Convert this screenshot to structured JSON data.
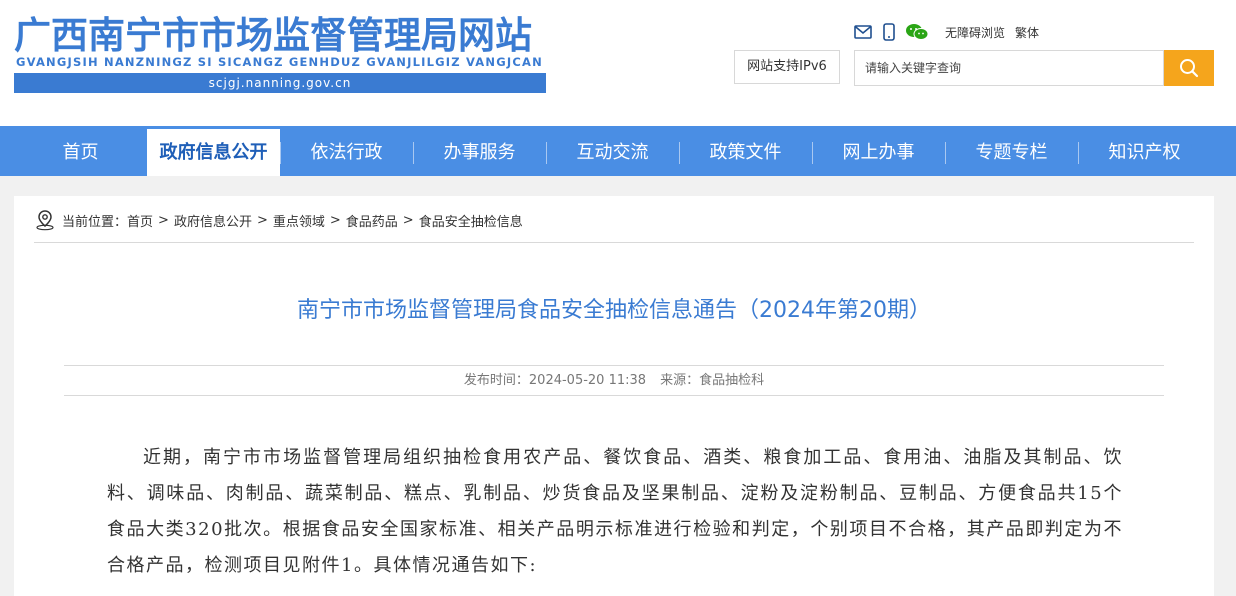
{
  "header": {
    "title": "广西南宁市市场监督管理局网站",
    "pinyin": "GVANGJSIH NANZNINGZ SI SICANGZ GENHDUZ GVANJLILGIZ VANGJCAN",
    "domain": "scjgj.nanning.gov.cn",
    "tools": {
      "icons": [
        "mail-icon",
        "mobile-icon",
        "wechat-icon"
      ],
      "accessibility": "无障碍浏览",
      "traditional": "繁体"
    },
    "ipv6": "网站支持IPv6",
    "search": {
      "placeholder": "请输入关键字查询"
    }
  },
  "nav": {
    "items": [
      {
        "label": "首页"
      },
      {
        "label": "政府信息公开"
      },
      {
        "label": "依法行政"
      },
      {
        "label": "办事服务"
      },
      {
        "label": "互动交流"
      },
      {
        "label": "政策文件"
      },
      {
        "label": "网上办事"
      },
      {
        "label": "专题专栏"
      },
      {
        "label": "知识产权"
      }
    ],
    "active_index": 1
  },
  "breadcrumb": {
    "prefix": "当前位置：",
    "items": [
      "首页",
      "政府信息公开",
      "重点领域",
      "食品药品",
      "食品安全抽检信息"
    ],
    "separator": ">"
  },
  "article": {
    "title": "南宁市市场监督管理局食品安全抽检信息通告（2024年第20期）",
    "publish_time": "发布时间：2024-05-20 11:38",
    "source": "来源：食品抽检科",
    "body": "近期，南宁市市场监督管理局组织抽检食用农产品、餐饮食品、酒类、粮食加工品、食用油、油脂及其制品、饮料、调味品、肉制品、蔬菜制品、糕点、乳制品、炒货食品及坚果制品、淀粉及淀粉制品、豆制品、方便食品共15个食品大类320批次。根据食品安全国家标准、相关产品明示标准进行检验和判定，个别项目不合格，其产品即判定为不合格产品，检测项目见附件1。具体情况通告如下:"
  },
  "colors": {
    "brand_blue": "#3a7bd2",
    "nav_blue": "#4a8ee4",
    "search_orange": "#f5a51c"
  }
}
